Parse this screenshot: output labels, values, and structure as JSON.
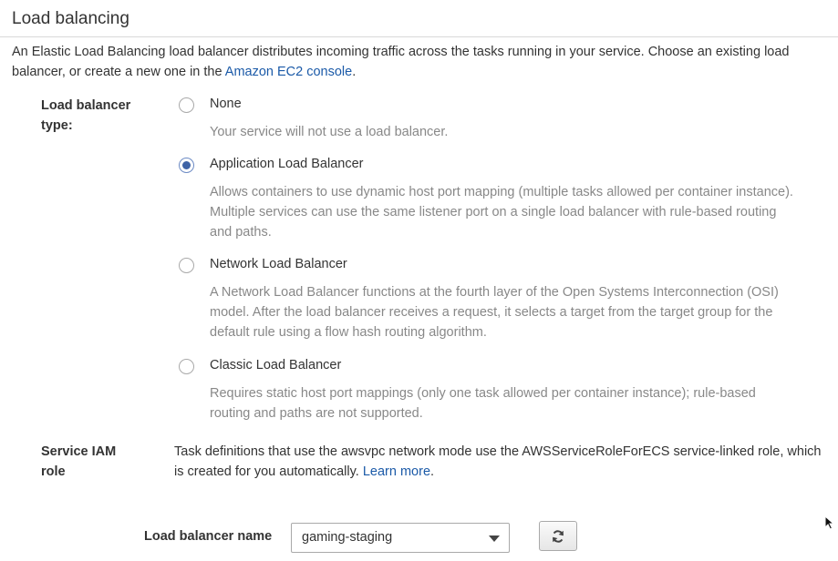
{
  "section": {
    "title": "Load balancing"
  },
  "intro": {
    "text": "An Elastic Load Balancing load balancer distributes incoming traffic across the tasks running in your service. Choose an existing load balancer, or create a new one in the ",
    "link_text": "Amazon EC2 console",
    "suffix": "."
  },
  "lb_type": {
    "label": "Load balancer type:",
    "selected": "Application Load Balancer",
    "options": [
      {
        "label": "None",
        "description": "Your service will not use a load balancer.",
        "checked": false
      },
      {
        "label": "Application Load Balancer",
        "description": "Allows containers to use dynamic host port mapping (multiple tasks allowed per container instance). Multiple services can use the same listener port on a single load balancer with rule-based routing and paths.",
        "checked": true
      },
      {
        "label": "Network Load Balancer",
        "description": "A Network Load Balancer functions at the fourth layer of the Open Systems Interconnection (OSI) model. After the load balancer receives a request, it selects a target from the target group for the default rule using a flow hash routing algorithm.",
        "checked": false
      },
      {
        "label": "Classic Load Balancer",
        "description": "Requires static host port mappings (only one task allowed per container instance); rule-based routing and paths are not supported.",
        "checked": false
      }
    ]
  },
  "iam": {
    "label": "Service IAM role",
    "text": "Task definitions that use the awsvpc network mode use the AWSServiceRoleForECS service-linked role, which is created for you automatically. ",
    "link_text": "Learn more",
    "suffix": "."
  },
  "lb_name": {
    "label": "Load balancer name",
    "value": "gaming-staging"
  },
  "icons": {
    "refresh": "refresh-icon",
    "caret": "chevron-down-icon"
  },
  "colors": {
    "link": "#1b5aa8",
    "radio_selected": "#3e63a6",
    "description_text": "#888888"
  }
}
